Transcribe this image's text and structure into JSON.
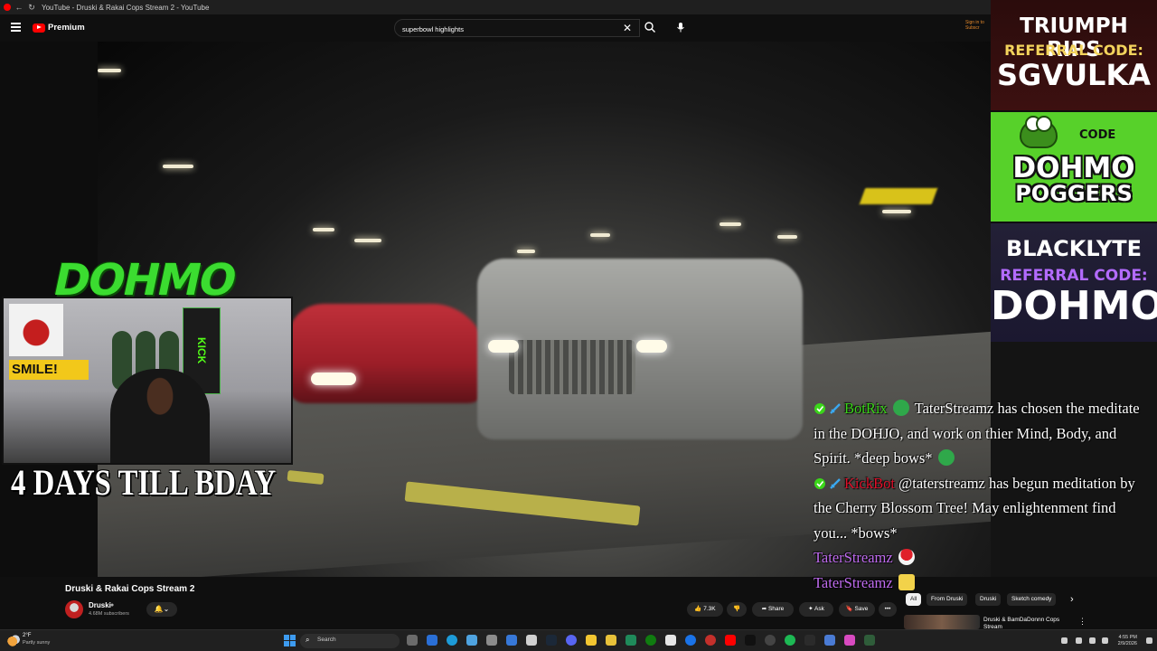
{
  "browser": {
    "tab_title": "YouTube - Druski & Rakai Cops Stream 2 - YouTube"
  },
  "header": {
    "brand": "Premium",
    "search_value": "superbowl highlights",
    "signin_text": "Sign in to Subscr"
  },
  "overlay": {
    "logo_text": "DOHMO",
    "bday_text": "4 DAYS TILL BDAY",
    "webcam": {
      "sign_text": "SMILE!",
      "kick_text": "KICK"
    }
  },
  "sponsors": [
    {
      "line1": "TRIUMPH RIPS",
      "line2": "REFERRAL CODE:",
      "line3": "SGVULKA"
    },
    {
      "line1": "CODE",
      "line2": "DOHMO",
      "line3": "POGGERS"
    },
    {
      "line1": "BLACKLYTE",
      "line2": "REFERRAL CODE:",
      "line3": "DOHMO"
    }
  ],
  "chat": [
    {
      "user": "BotRix",
      "message": "TaterStreamz has chosen the meditate in the DOHJO, and work on thier Mind, Body, and Spirit. *deep bows*"
    },
    {
      "user": "KickBot",
      "message": "@taterstreamz has begun meditation by the Cherry Blossom Tree! May enlightenment find you... *bows*"
    },
    {
      "user": "TaterStreamz",
      "message": ""
    },
    {
      "user": "TaterStreamz",
      "message": ""
    }
  ],
  "video": {
    "title": "Druski & Rakai Cops Stream 2",
    "channel": "Druski",
    "subscribers": "4.68M subscribers",
    "likes": "7.3K",
    "share_label": "Share",
    "ask_label": "Ask",
    "save_label": "Save"
  },
  "recommendations": {
    "chips": [
      "All",
      "From Druski",
      "Druski",
      "Sketch comedy"
    ],
    "first_title": "Druski & BamDaDonnn Cops Stream"
  },
  "taskbar": {
    "temperature": "2°F",
    "weather": "Partly sunny",
    "search_label": "Search",
    "time": "4:55 PM",
    "date": "2/9/2026"
  }
}
